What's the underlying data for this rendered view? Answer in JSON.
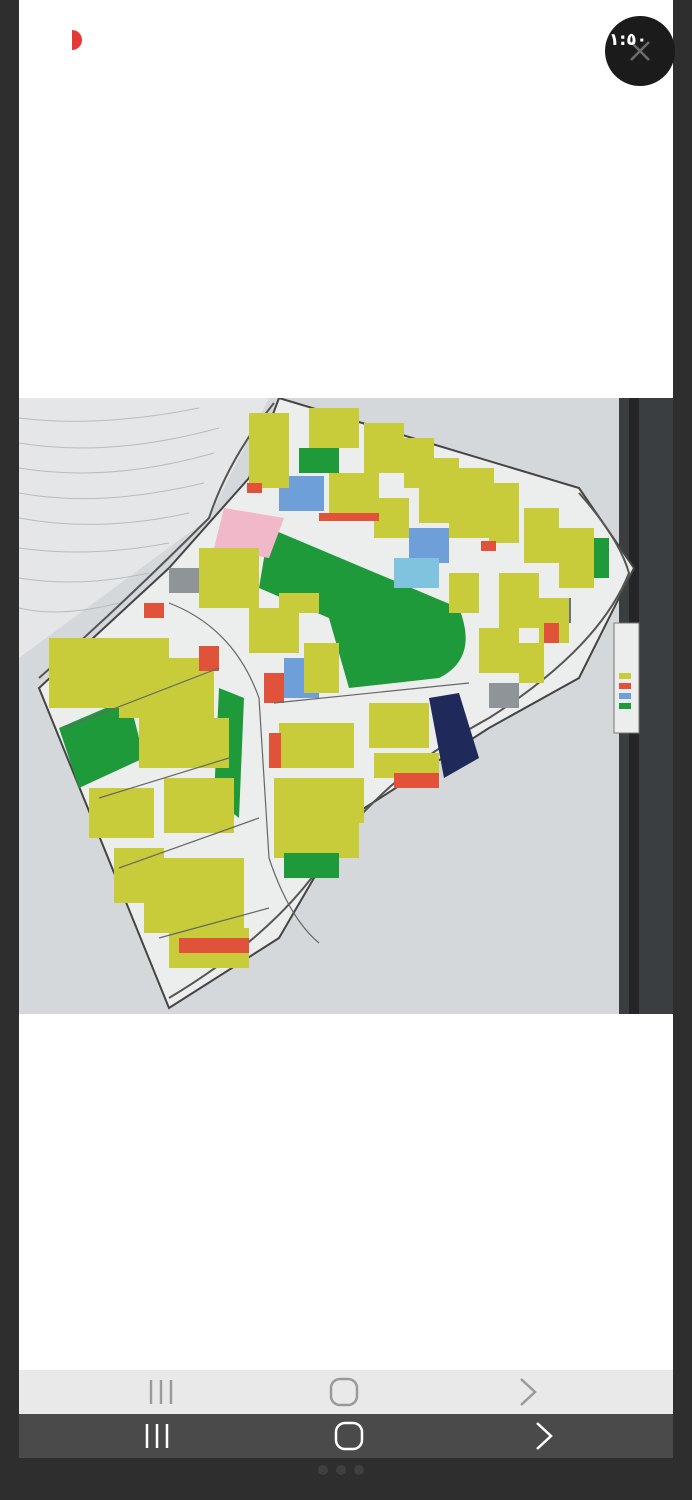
{
  "status": {
    "timer": "١:٥٠"
  },
  "story": {
    "progress_fraction": 0.02,
    "progress_color": "#e53935"
  },
  "controls": {
    "close_icon": "close-icon"
  },
  "image": {
    "kind": "site-plan-photo",
    "colors": {
      "residential": "#c8cc3a",
      "green_space": "#1f9a3a",
      "services": "#6f9fd8",
      "commercial": "#e0523a",
      "admin": "#f0b8c8",
      "industrial": "#1f2a5a",
      "utility": "#8f9499",
      "road": "#e9eaea"
    }
  },
  "navigation": {
    "recents_icon": "recents-icon",
    "home_icon": "home-icon",
    "back_icon": "back-icon"
  }
}
